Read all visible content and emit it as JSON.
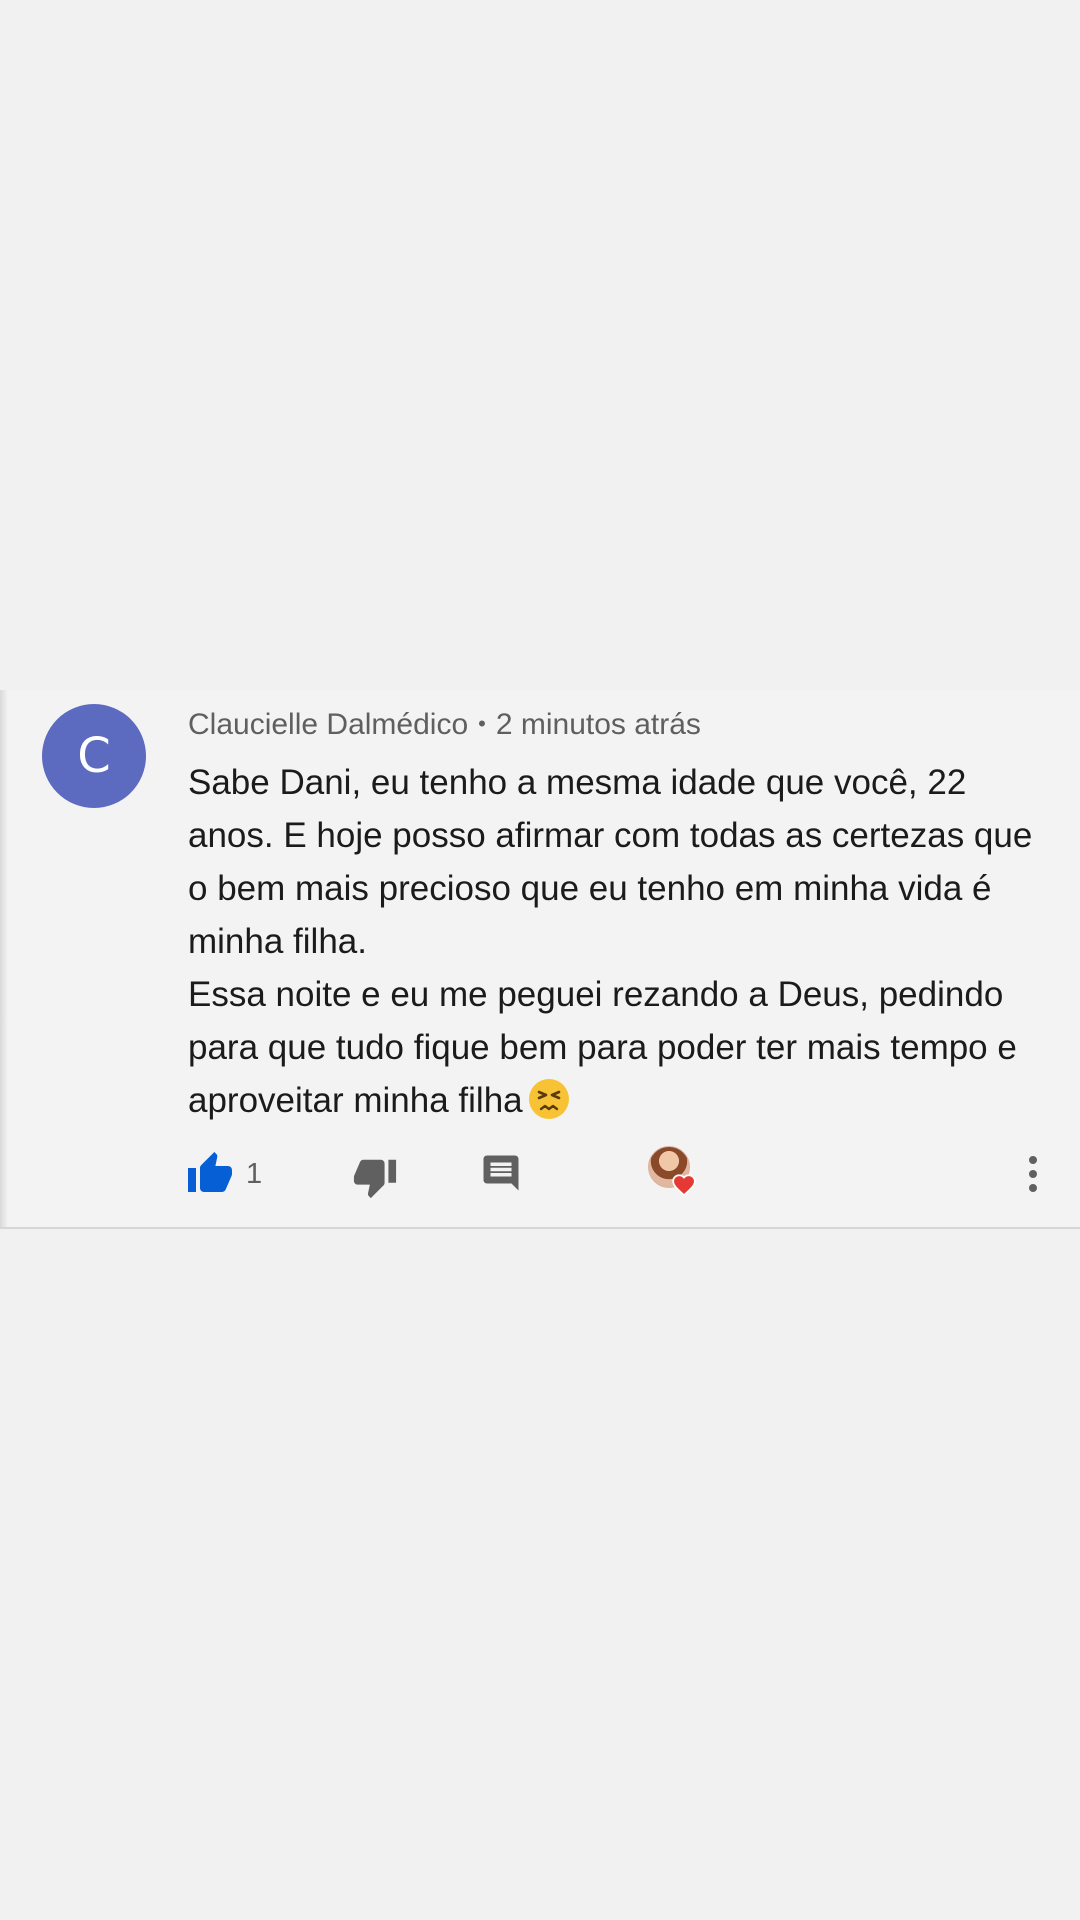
{
  "comment": {
    "avatar_letter": "C",
    "avatar_color": "#5c6bc0",
    "author": "Claucielle Dalmédico",
    "separator": "•",
    "time": "2 minutos atrás",
    "paragraphs": [
      "Sabe Dani, eu tenho a mesma idade que você, 22 anos. E hoje posso afirmar com todas as certezas que o bem mais precioso que eu tenho em minha vida é minha filha.",
      "Essa noite e eu me peguei rezando a Deus, pedindo para que tudo fique bem para poder ter mais tempo e aproveitar minha filha"
    ],
    "emoji": "persevering-face-emoji"
  },
  "actions": {
    "like_count": "1",
    "like_color": "#065fd4",
    "icon_color": "#606060",
    "heart_color": "#e53935",
    "icons": [
      "thumbs-up-icon",
      "thumbs-down-icon",
      "reply-icon",
      "creator-heart-icon",
      "more-vert-icon"
    ]
  }
}
